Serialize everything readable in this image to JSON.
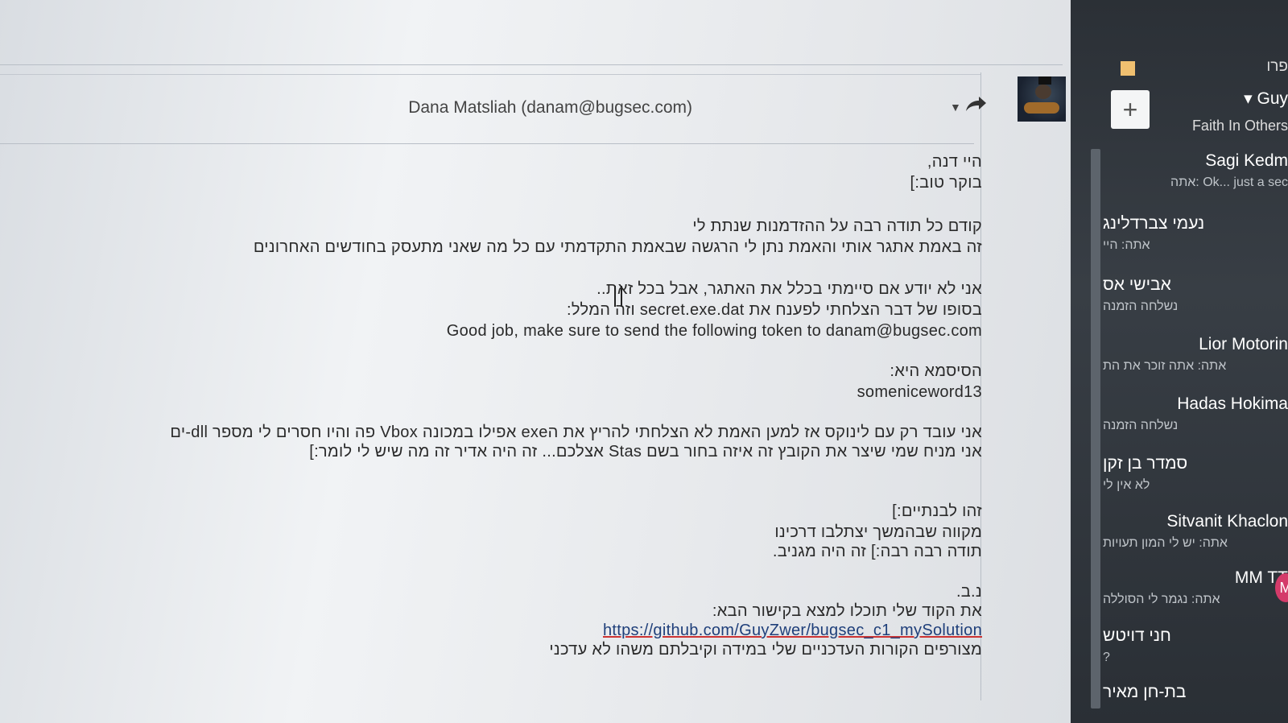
{
  "email": {
    "sender": "Dana Matsliah (danam@bugsec.com)",
    "greeting": "היי דנה,",
    "line2": "בוקר טוב:]",
    "line3": "קודם כל תודה רבה על ההזדמנות שנתת לי",
    "line4": "זה באמת אתגר אותי והאמת נתן לי הרגשה שבאמת התקדמתי עם כל מה שאני מתעסק בחודשים האחרונים",
    "line5": "אני לא יודע אם סיימתי בכלל את האתגר, אבל בכל זאת..",
    "line6": "בסופו של דבר הצלחתי לפענח את secret.exe.dat וזה המלל:",
    "line7": "Good job, make sure to send the following token to danam@bugsec.com",
    "line8": "הסיסמא היא:",
    "line9": "someniceword13",
    "line10": "אני עובד רק עם לינוקס אז למען האמת לא הצלחתי להריץ את הexe אפילו במכונה Vbox פה והיו חסרים לי מספר dll-ים",
    "line11": "אני מניח שמי שיצר את הקובץ זה איזה בחור בשם Stas אצלכם... זה היה אדיר זה מה שיש לי לומר:]",
    "line12": "זהו לבנתיים:]",
    "line13": "מקווה שבהמשך יצתלבו דרכינו",
    "line14": "תודה רבה רבה:] זה היה מגניב.",
    "line15": "נ.ב.",
    "line16": "את הקוד שלי תוכלו למצא בקישור הבא:",
    "link": "https://github.com/GuyZwer/bugsec_c1_mySolution",
    "line17": "מצורפים הקורות העדכניים שלי במידה וקיבלתם משהו לא עדכני"
  },
  "chat": {
    "title": "פרו",
    "add_label": "+",
    "self_name": "▾ Guy",
    "self_status": "Faith In Others",
    "contacts": [
      {
        "name": "Sagi Kedm",
        "preview": "אתה: Ok... just a sec"
      },
      {
        "name": "נעמי צברדלינג",
        "preview": "אתה: היי"
      },
      {
        "name": "אבישי אס",
        "preview": "נשלחה הזמנה"
      },
      {
        "name": "Lior Motorin",
        "preview": "אתה: אתה זוכר את הת"
      },
      {
        "name": "Hadas Hokima",
        "preview": "נשלחה הזמנה"
      },
      {
        "name": "סמדר בן זקן",
        "preview": "לא אין לי"
      },
      {
        "name": "Sitvanit Khaclon",
        "preview": "אתה: יש לי המון תעויות"
      },
      {
        "name": "MM TT",
        "preview": "אתה: נגמר לי הסוללה",
        "badge": "M"
      },
      {
        "name": "חני דויטש",
        "preview": "?"
      },
      {
        "name": "בת-חן מאיר",
        "preview": ""
      }
    ]
  }
}
